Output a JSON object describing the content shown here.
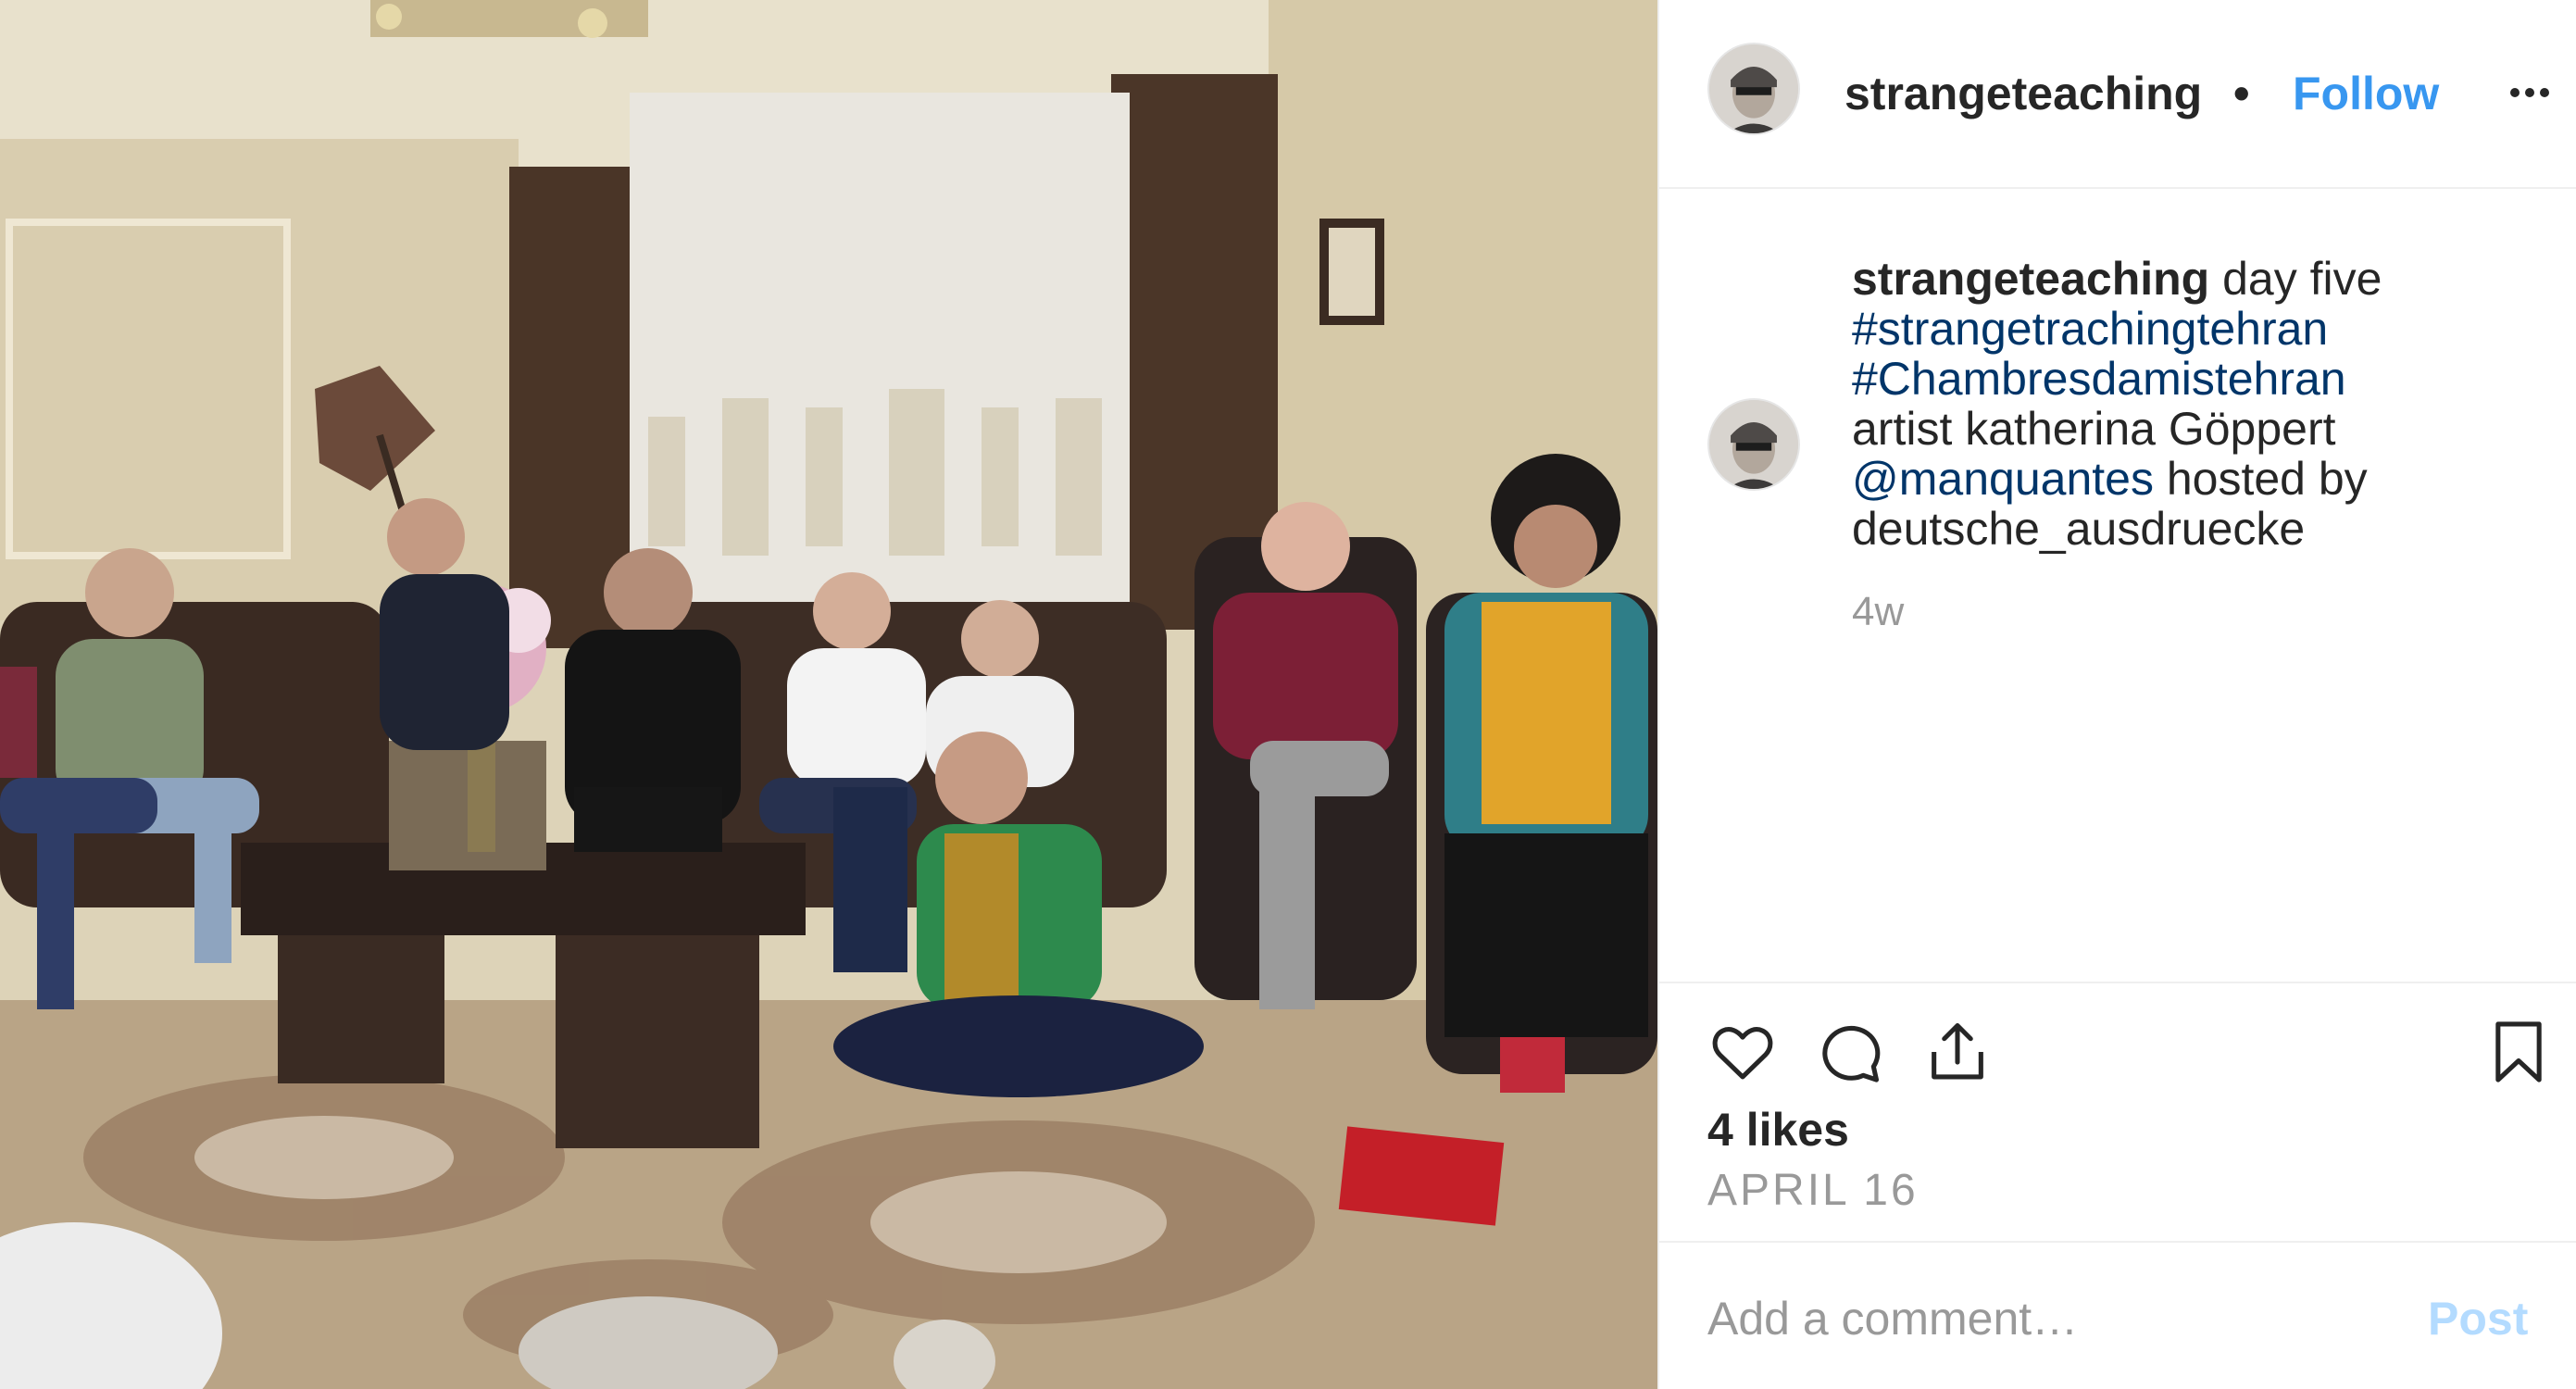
{
  "post": {
    "username": "strangeteaching",
    "follow_label": "Follow",
    "separator": "•",
    "caption": {
      "username": "strangeteaching",
      "line1_text": "day five",
      "hashtag1": "#strangetrachingtehran",
      "hashtag2": "#Chambresdamistehran",
      "line4": "artist katherina Göppert",
      "mention": "@manquantes",
      "line5_rest": "hosted by",
      "line6": "deutsche_ausdruecke",
      "time_ago": "4w"
    },
    "likes": "4 likes",
    "date": "APRIL 16",
    "comment_placeholder": "Add a comment…",
    "post_label": "Post"
  },
  "icons": {
    "more": "more-options-icon",
    "like": "heart-icon",
    "comment": "comment-bubble-icon",
    "share": "share-icon",
    "save": "bookmark-icon"
  },
  "colors": {
    "link_blue": "#3897f0",
    "hashtag_blue": "#003569",
    "text": "#262626",
    "muted": "#999999",
    "post_disabled": "#b3dbff"
  }
}
